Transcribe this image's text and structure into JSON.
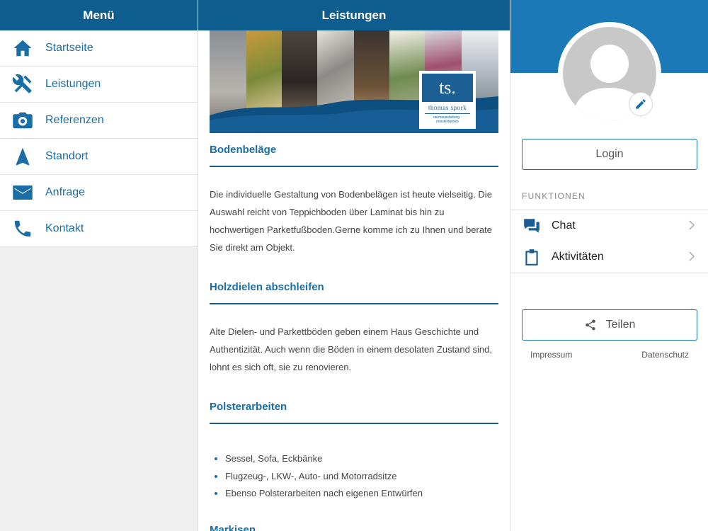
{
  "menu": {
    "title": "Menü",
    "items": [
      {
        "label": "Startseite",
        "icon": "home-icon"
      },
      {
        "label": "Leistungen",
        "icon": "tools-icon"
      },
      {
        "label": "Referenzen",
        "icon": "camera-icon"
      },
      {
        "label": "Standort",
        "icon": "navigation-arrow-icon"
      },
      {
        "label": "Anfrage",
        "icon": "mail-icon"
      },
      {
        "label": "Kontakt",
        "icon": "phone-icon"
      }
    ]
  },
  "content": {
    "title": "Leistungen",
    "banner": {
      "logo_mark": "ts.",
      "logo_name": "thomas spork",
      "logo_sub": "raumausstattung · meisterbetrieb"
    },
    "sections": [
      {
        "title": "Bodenbeläge",
        "text": "Die individuelle Gestaltung von Bodenbelägen ist heute vielseitig. Die Auswahl reicht von Teppichboden über Laminat bis hin zu hochwertigen Parketfußboden.Gerne komme ich zu Ihnen und berate Sie direkt am Objekt."
      },
      {
        "title": "Holzdielen abschleifen",
        "text": "Alte Dielen- und Parkettböden geben einem Haus Geschichte und Authentizität. Auch wenn die Böden in einem desolaten Zustand sind, lohnt es sich oft, sie zu renovieren."
      },
      {
        "title": "Polsterarbeiten",
        "list": [
          "Sessel, Sofa, Eckbänke",
          "Flugzeug-, LKW-, Auto- und Motorradsitze",
          "Ebenso Polsterarbeiten nach eigenen Entwürfen"
        ]
      },
      {
        "title": "Markisen"
      }
    ]
  },
  "profile": {
    "login_label": "Login",
    "functions_label": "FUNKTIONEN",
    "functions": [
      {
        "label": "Chat",
        "icon": "chat-icon"
      },
      {
        "label": "Aktivitäten",
        "icon": "clipboard-icon"
      }
    ],
    "share_label": "Teilen",
    "footer": {
      "impressum": "Impressum",
      "datenschutz": "Datenschutz"
    }
  },
  "colors": {
    "header_bg": "#0e5d8f",
    "accent": "#1a6ea6",
    "profile_band": "#1a79b6"
  }
}
